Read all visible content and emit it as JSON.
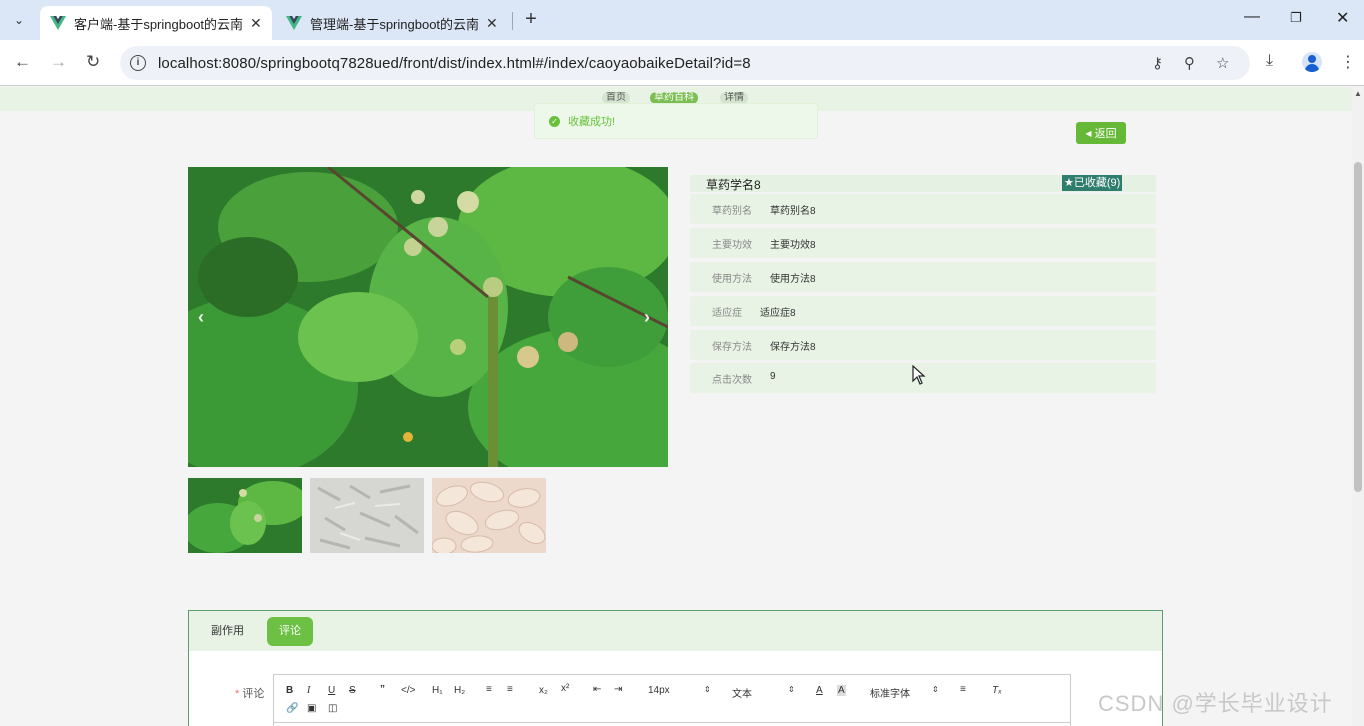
{
  "browser": {
    "tabs": [
      {
        "title": "客户端-基于springboot的云南",
        "active": true
      },
      {
        "title": "管理端-基于springboot的云南",
        "active": false
      }
    ],
    "url": "localhost:8080/springbootq7828ued/front/dist/index.html#/index/caoyaobaikeDetail?id=8"
  },
  "breadcrumb": [
    "首页",
    "草药百科",
    "详情"
  ],
  "toast": {
    "message": "收藏成功!"
  },
  "back_button": "返回",
  "detail": {
    "title": "草药学名8",
    "favorite_label": "已收藏(9)",
    "fields": [
      {
        "label": "草药别名",
        "value": "草药别名8"
      },
      {
        "label": "主要功效",
        "value": "主要功效8"
      },
      {
        "label": "使用方法",
        "value": "使用方法8"
      },
      {
        "label": "适应症",
        "value": "适应症8"
      },
      {
        "label": "保存方法",
        "value": "保存方法8"
      },
      {
        "label": "点击次数",
        "value": "9"
      }
    ]
  },
  "content_tabs": [
    "副作用",
    "评论"
  ],
  "comment_form": {
    "label": "评论",
    "toolbar": {
      "font_size": "14px",
      "format": "文本",
      "font": "标准字体"
    }
  },
  "watermark": "CSDN @学长毕业设计",
  "colors": {
    "accent": "#67c23a",
    "active_tab": "#6cc043",
    "fav_bg": "#2f7d6d"
  }
}
